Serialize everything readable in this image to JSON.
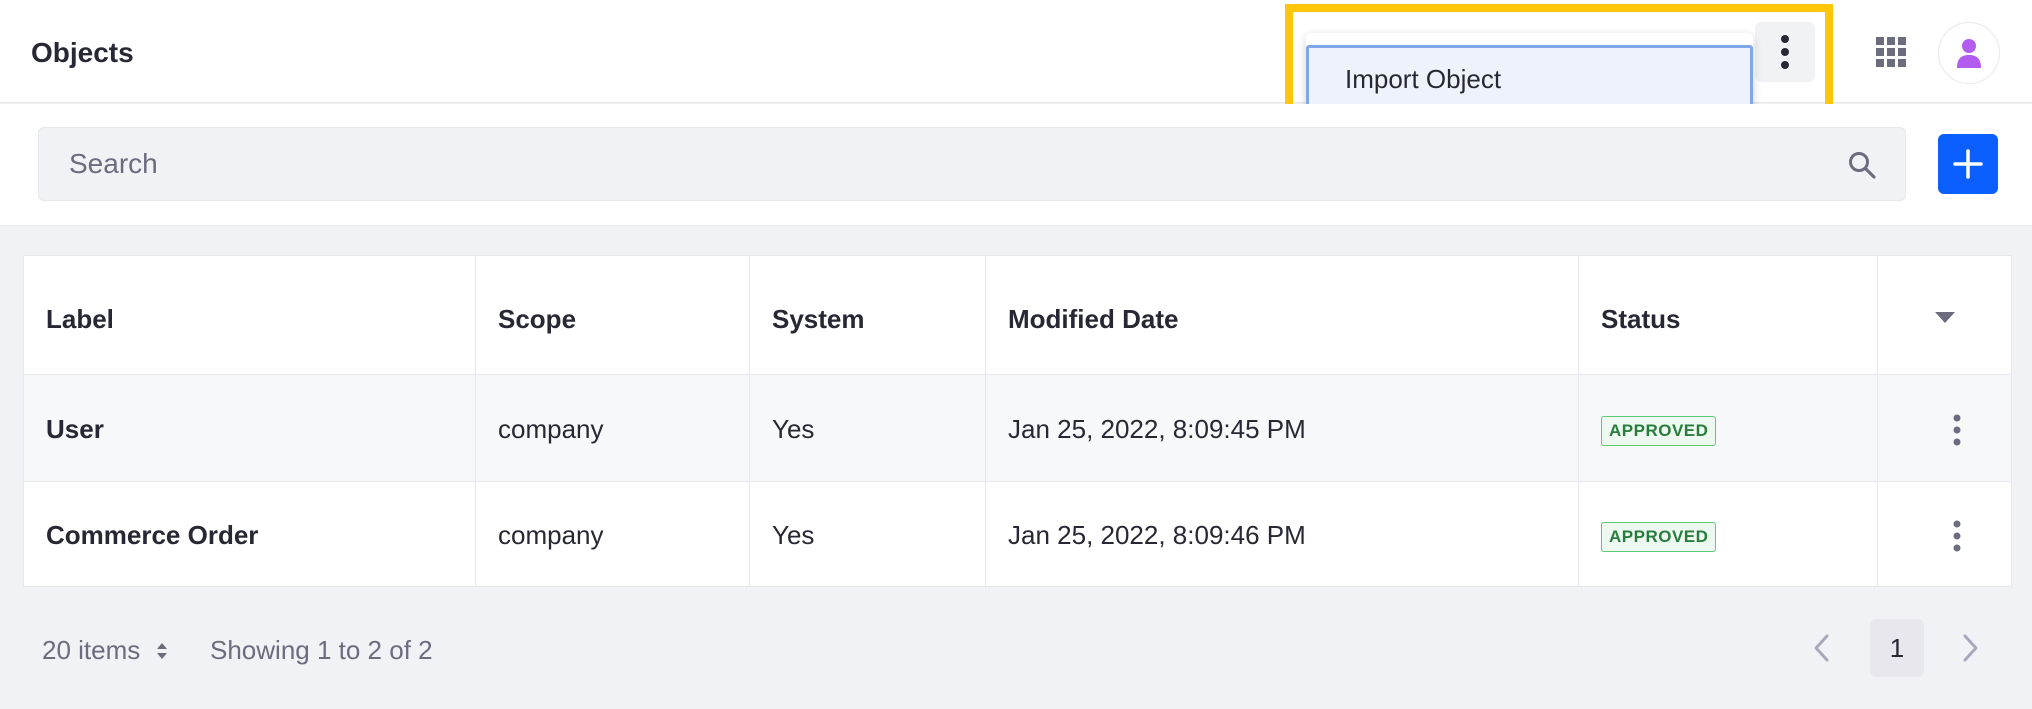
{
  "header": {
    "title": "Objects"
  },
  "actions_menu": {
    "items": [
      {
        "label": "Import Object"
      }
    ]
  },
  "search": {
    "placeholder": "Search"
  },
  "table": {
    "columns": [
      "Label",
      "Scope",
      "System",
      "Modified Date",
      "Status"
    ],
    "rows": [
      {
        "label": "User",
        "scope": "company",
        "system": "Yes",
        "modified": "Jan 25, 2022, 8:09:45 PM",
        "status": "APPROVED"
      },
      {
        "label": "Commerce Order",
        "scope": "company",
        "system": "Yes",
        "modified": "Jan 25, 2022, 8:09:46 PM",
        "status": "APPROVED"
      }
    ]
  },
  "pagination": {
    "items_per_page": "20 items",
    "showing": "Showing 1 to 2 of 2",
    "current_page": "1"
  },
  "colors": {
    "primary": "#0b5fff",
    "highlight": "#ffc60b",
    "approved": "#287d3c"
  },
  "icons": {
    "menu": "kebab-vertical-icon",
    "apps": "apps-grid-icon",
    "user": "user-avatar-icon",
    "search": "search-icon",
    "add": "plus-icon",
    "sort": "caret-down-icon",
    "prev": "chevron-left-icon",
    "next": "chevron-right-icon"
  }
}
